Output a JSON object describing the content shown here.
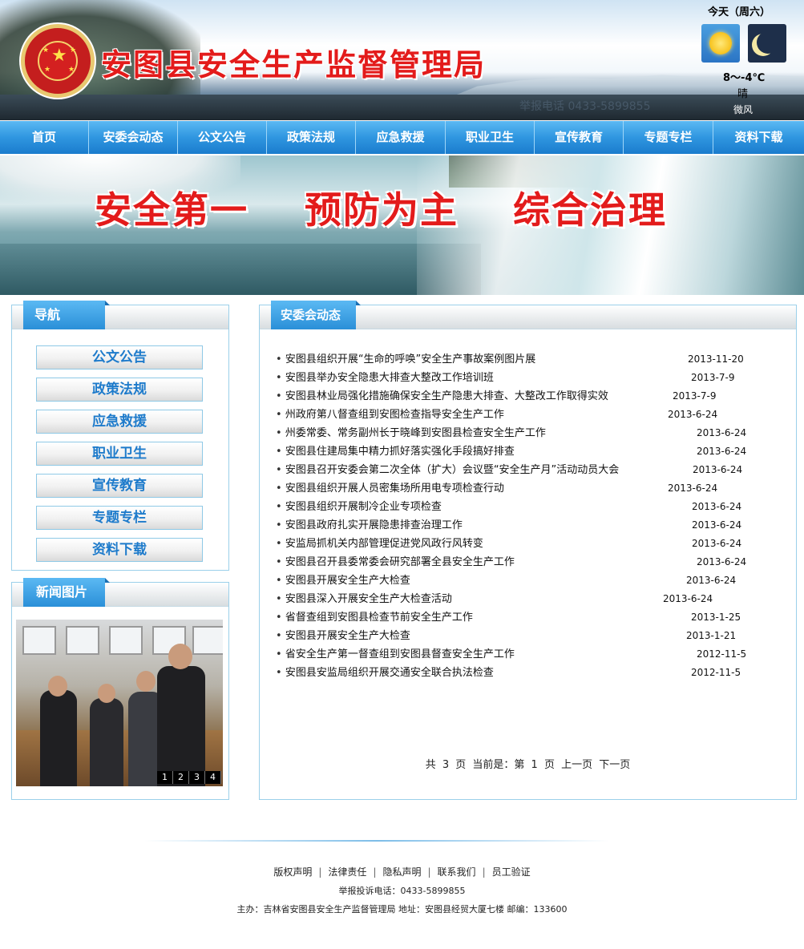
{
  "header": {
    "site_title": "安图县安全生产监督管理局",
    "hotline_faint": "举报电话 0433-5899855"
  },
  "weather": {
    "day": "今天（周六）",
    "temp": "8～-4℃",
    "desc": "晴",
    "wind": "微风"
  },
  "nav": {
    "items": [
      "首页",
      "安委会动态",
      "公文公告",
      "政策法规",
      "应急救援",
      "职业卫生",
      "宣传教育",
      "专题专栏",
      "资料下载"
    ]
  },
  "banner": {
    "slogan1": "安全第一",
    "slogan2": "预防为主",
    "slogan3": "综合治理"
  },
  "sidebar": {
    "nav_title": "导航",
    "buttons": [
      "公文公告",
      "政策法规",
      "应急救援",
      "职业卫生",
      "宣传教育",
      "专题专栏",
      "资料下载"
    ],
    "photo_title": "新闻图片",
    "photo_pager": [
      "1",
      "2",
      "3",
      "4"
    ]
  },
  "main": {
    "title": "安委会动态",
    "news": [
      {
        "title": "安图县组织开展“生命的呼唤”安全生产事故案例图片展",
        "date": "2013-11-20"
      },
      {
        "title": "安图县举办安全隐患大排查大整改工作培训班",
        "date": "2013-7-9"
      },
      {
        "title": "安图县林业局强化措施确保安全生产隐患大排查、大整改工作取得实效",
        "date": "2013-7-9"
      },
      {
        "title": "州政府第八督查组到安图检查指导安全生产工作",
        "date": "2013-6-24"
      },
      {
        "title": "州委常委、常务副州长于晓峰到安图县检查安全生产工作",
        "date": "2013-6-24"
      },
      {
        "title": "安图县住建局集中精力抓好落实强化手段搞好排查",
        "date": "2013-6-24"
      },
      {
        "title": "安图县召开安委会第二次全体（扩大）会议暨“安全生产月”活动动员大会",
        "date": "2013-6-24"
      },
      {
        "title": "安图县组织开展人员密集场所用电专项检查行动",
        "date": "2013-6-24"
      },
      {
        "title": "安图县组织开展制冷企业专项检查",
        "date": "2013-6-24"
      },
      {
        "title": "安图县政府扎实开展隐患排查治理工作",
        "date": "2013-6-24"
      },
      {
        "title": "安监局抓机关内部管理促进党风政行风转变",
        "date": "2013-6-24"
      },
      {
        "title": "安图县召开县委常委会研究部署全县安全生产工作",
        "date": "2013-6-24"
      },
      {
        "title": "安图县开展安全生产大检查",
        "date": "2013-6-24"
      },
      {
        "title": "安图县深入开展安全生产大检查活动",
        "date": "2013-6-24"
      },
      {
        "title": "省督查组到安图县检查节前安全生产工作",
        "date": "2013-1-25"
      },
      {
        "title": "安图县开展安全生产大检查",
        "date": "2013-1-21"
      },
      {
        "title": "省安全生产第一督查组到安图县督查安全生产工作",
        "date": "2012-11-5"
      },
      {
        "title": "安图县安监局组织开展交通安全联合执法检查",
        "date": "2012-11-5"
      }
    ],
    "pagination": {
      "total": "共 3 页",
      "current": "当前是：第 1 页",
      "prev": "上一页",
      "next": "下一页"
    }
  },
  "footer": {
    "links": [
      "版权声明",
      "法律责任",
      "隐私声明",
      "联系我们",
      "员工验证"
    ],
    "hotline": "举报投诉电话：0433-5899855",
    "host": "主办：吉林省安图县安全生产监督管理局 地址：安图县经贸大厦七楼 邮编：133600"
  }
}
